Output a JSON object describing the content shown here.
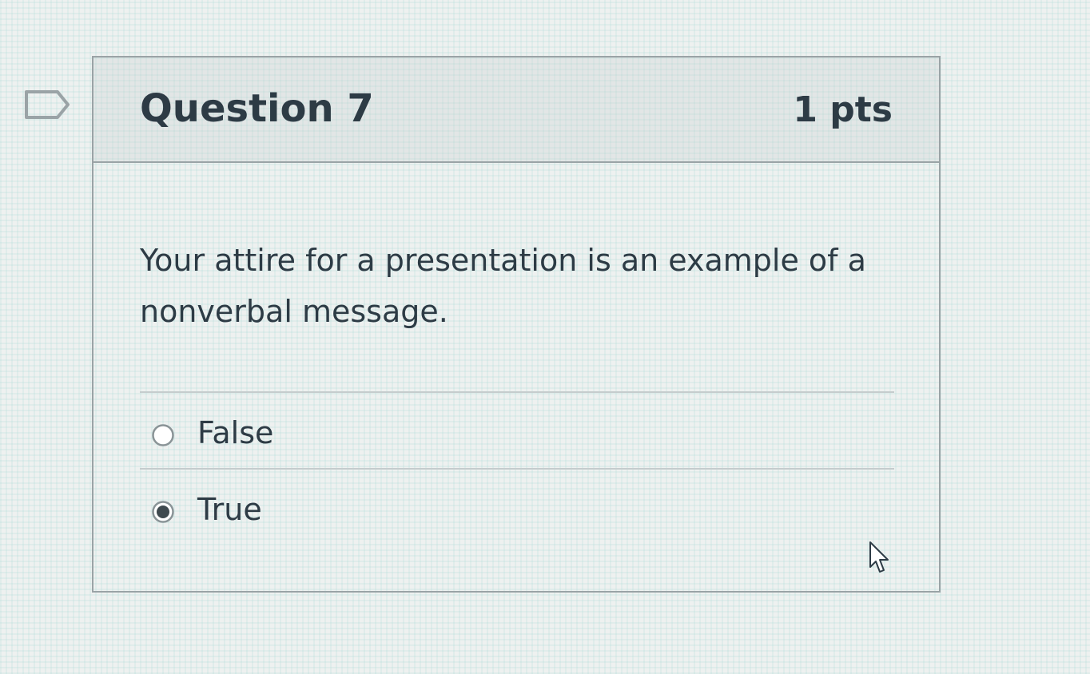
{
  "question": {
    "title": "Question 7",
    "points": "1 pts",
    "text": "Your attire for a presentation is an example of a nonverbal message.",
    "flag_icon": "flag-icon",
    "answers": [
      {
        "label": "False",
        "selected": false
      },
      {
        "label": "True",
        "selected": true
      }
    ]
  },
  "colors": {
    "text": "#2d3b45",
    "border": "#9aa3a6",
    "radio_selected": "#3f4a4f"
  }
}
